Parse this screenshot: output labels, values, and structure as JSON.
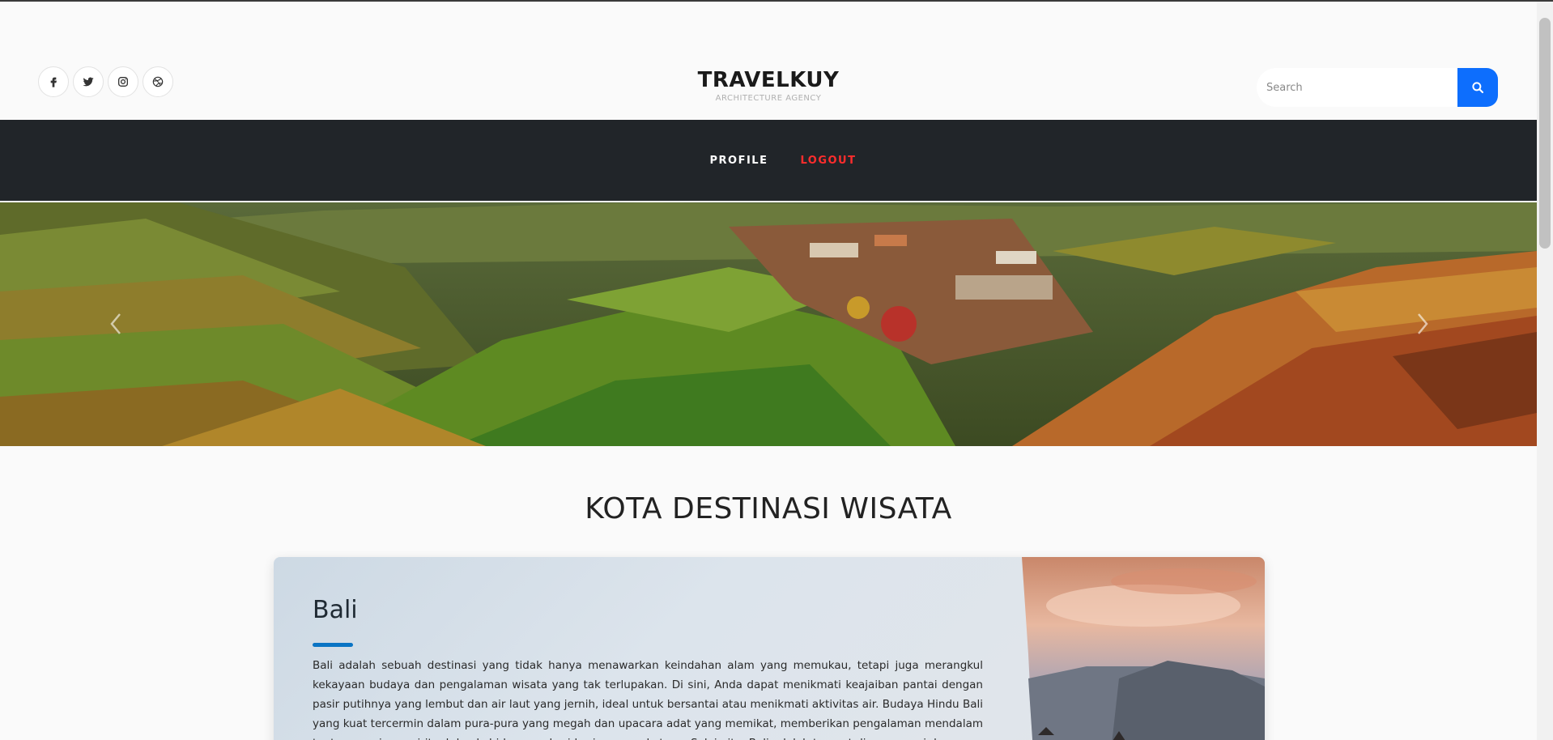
{
  "header": {
    "social": [
      {
        "name": "facebook-icon"
      },
      {
        "name": "twitter-icon"
      },
      {
        "name": "instagram-icon"
      },
      {
        "name": "dribbble-icon"
      }
    ],
    "brand_title": "TRAVELKUY",
    "brand_subtitle": "ARCHITECTURE AGENCY",
    "search_placeholder": "Search"
  },
  "nav": {
    "profile": "PROFILE",
    "logout": "LOGOUT"
  },
  "colors": {
    "navbar": "#212529",
    "accent": "#0d6efd",
    "logout": "#ff2d2d",
    "underline": "#0a74c4"
  },
  "section": {
    "title": "KOTA DESTINASI WISATA"
  },
  "card": {
    "title": "Bali",
    "text": "Bali adalah sebuah destinasi yang tidak hanya menawarkan keindahan alam yang memukau, tetapi juga merangkul kekayaan budaya dan pengalaman wisata yang tak terlupakan. Di sini, Anda dapat menikmati keajaiban pantai dengan pasir putihnya yang lembut dan air laut yang jernih, ideal untuk bersantai atau menikmati aktivitas air. Budaya Hindu Bali yang kuat tercermin dalam pura-pura yang megah dan upacara adat yang memikat, memberikan pengalaman mendalam tentang warisan spiritual dan kehidupan sehari-hari masyarakatnya. Selain itu, Bali adalah tempat di mana seni dan"
  }
}
